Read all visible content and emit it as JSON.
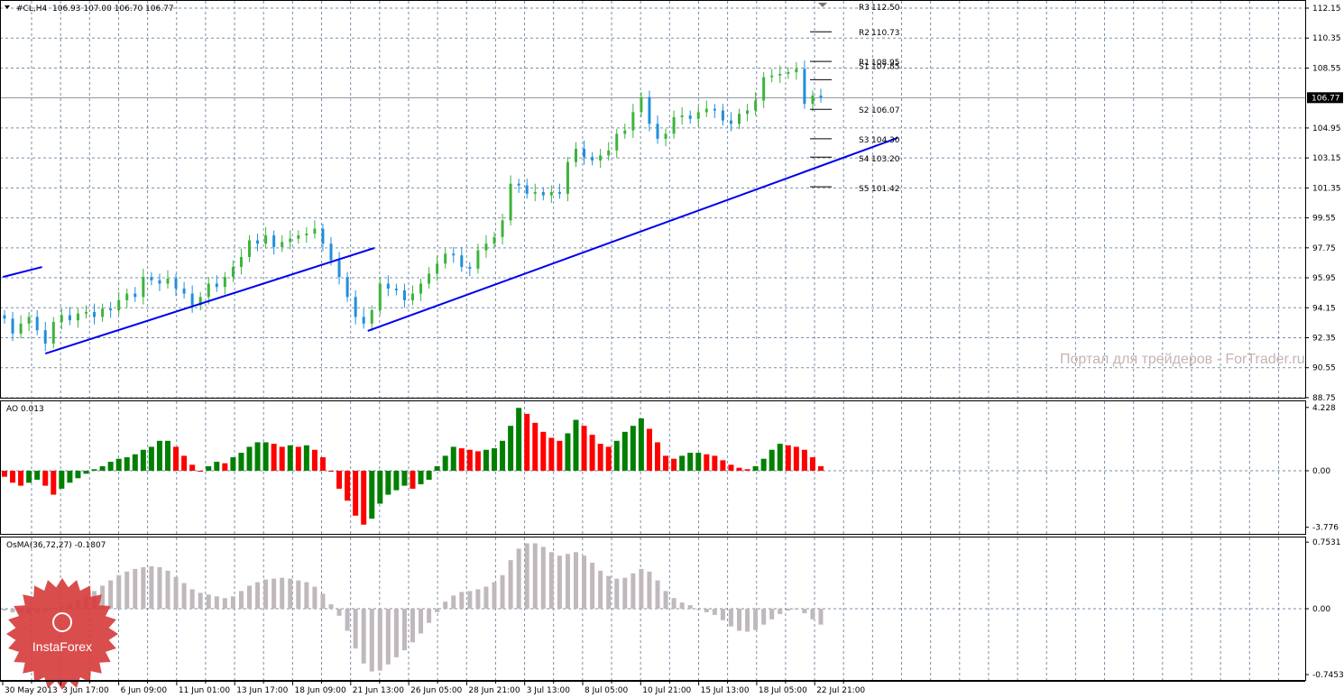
{
  "header": {
    "symbol": "#CL,H4",
    "ohlc": "106.93 107.00 106.70 106.77"
  },
  "watermark": "Портал для трейдеров - ForTrader.ru",
  "logo": {
    "text": "InstaForex",
    "color": "#d63a3a"
  },
  "colors": {
    "bull": "#3cb43c",
    "bear": "#1f8fdc",
    "trendline": "#0000ee",
    "ao_up": "#008000",
    "ao_down": "#ff0000",
    "osma": "#c0b8bc"
  },
  "chart_data": [
    {
      "type": "candlestick",
      "title": "#CL,H4",
      "ylim": [
        88.75,
        112.15
      ],
      "y_ticks": [
        "112.15",
        "110.35",
        "108.55",
        "104.95",
        "103.15",
        "101.35",
        "99.55",
        "97.75",
        "95.95",
        "94.15",
        "92.35",
        "90.55",
        "88.75"
      ],
      "current_price": "106.77",
      "x_tick_labels": [
        "30 May 2013",
        "3 Jun 17:00",
        "6 Jun 09:00",
        "11 Jun 01:00",
        "13 Jun 17:00",
        "18 Jun 09:00",
        "21 Jun 13:00",
        "26 Jun 05:00",
        "28 Jun 21:00",
        "3 Jul 13:00",
        "8 Jul 05:00",
        "10 Jul 21:00",
        "15 Jul 13:00",
        "18 Jul 05:00",
        "22 Jul 21:00"
      ],
      "closes": [
        93.5,
        92.6,
        93.2,
        93.6,
        92.8,
        92.0,
        93.3,
        93.7,
        93.4,
        93.8,
        93.9,
        93.6,
        94.1,
        94.0,
        94.6,
        95.0,
        94.8,
        96.0,
        95.8,
        95.6,
        95.9,
        95.3,
        95.0,
        94.3,
        94.8,
        95.6,
        95.4,
        96.0,
        96.6,
        97.2,
        98.2,
        98.0,
        98.5,
        97.8,
        98.1,
        98.3,
        98.5,
        98.6,
        98.9,
        98.0,
        97.0,
        96.0,
        94.8,
        93.6,
        93.2,
        94.0,
        95.6,
        95.3,
        95.2,
        94.6,
        95.0,
        95.6,
        96.2,
        96.8,
        97.4,
        97.3,
        96.6,
        96.5,
        97.6,
        98.0,
        98.4,
        99.4,
        101.6,
        101.5,
        101.0,
        101.1,
        100.9,
        101.1,
        101.0,
        102.9,
        103.7,
        103.2,
        103.0,
        103.3,
        103.6,
        104.6,
        104.8,
        105.9,
        106.8,
        105.2,
        104.3,
        104.6,
        105.6,
        105.7,
        105.5,
        105.9,
        106.1,
        106.0,
        105.4,
        105.2,
        105.8,
        106.0,
        106.6,
        108.0,
        108.1,
        108.2,
        108.3,
        108.5,
        106.4,
        106.9,
        106.77
      ],
      "pivots": [
        {
          "label": "R3",
          "value": "112.50"
        },
        {
          "label": "R2",
          "value": "110.73"
        },
        {
          "label": "R1",
          "value": "108.95"
        },
        {
          "label": "S1",
          "value": "107.85"
        },
        {
          "label": "S2",
          "value": "106.07"
        },
        {
          "label": "S3",
          "value": "104.30"
        },
        {
          "label": "S4",
          "value": "103.20"
        },
        {
          "label": "S5",
          "value": "101.42"
        }
      ],
      "trendlines": [
        {
          "from": [
            -0.2,
            96.0
          ],
          "to": [
            4.6,
            96.6
          ]
        },
        {
          "from": [
            5.0,
            91.4
          ],
          "to": [
            45.3,
            97.74
          ]
        },
        {
          "from": [
            44.5,
            92.76
          ],
          "to": [
            109.4,
            104.35
          ]
        }
      ]
    },
    {
      "type": "bar",
      "title": "AO 0.013",
      "ylim": [
        -3.776,
        4.228
      ],
      "y_ticks": [
        "4.228",
        "0.00",
        "-3.776"
      ],
      "values": [
        -0.4,
        -0.8,
        -1.0,
        -0.8,
        -0.6,
        -1.0,
        -1.6,
        -1.2,
        -0.8,
        -0.5,
        -0.2,
        0.1,
        0.3,
        0.6,
        0.8,
        0.9,
        1.1,
        1.4,
        1.6,
        2.0,
        2.0,
        1.6,
        1.0,
        0.4,
        0.0,
        0.3,
        0.6,
        0.5,
        0.9,
        1.2,
        1.6,
        1.9,
        1.9,
        1.8,
        1.6,
        1.7,
        1.6,
        1.7,
        1.4,
        0.9,
        0.0,
        -1.2,
        -2.0,
        -3.0,
        -3.6,
        -3.2,
        -2.2,
        -1.6,
        -1.3,
        -1.0,
        -1.2,
        -0.9,
        -0.6,
        0.3,
        1.0,
        1.6,
        1.5,
        1.4,
        1.3,
        1.4,
        1.5,
        2.0,
        3.0,
        4.2,
        3.8,
        3.2,
        2.6,
        2.2,
        2.0,
        2.5,
        3.4,
        3.0,
        2.4,
        1.8,
        1.6,
        2.0,
        2.6,
        3.0,
        3.5,
        2.8,
        1.9,
        1.0,
        0.8,
        1.0,
        1.2,
        1.2,
        1.1,
        1.0,
        0.7,
        0.4,
        0.2,
        0.1,
        0.3,
        0.8,
        1.4,
        1.8,
        1.7,
        1.6,
        1.4,
        0.9,
        0.3
      ]
    },
    {
      "type": "bar",
      "title": "OsMA(36,72,27) -0.1807",
      "ylim": [
        -0.7453,
        0.7531
      ],
      "y_ticks": [
        "0.7531",
        "0.00",
        "-0.7453"
      ],
      "values": [
        -0.02,
        -0.04,
        -0.05,
        -0.06,
        -0.05,
        -0.03,
        0.0,
        0.03,
        0.06,
        0.1,
        0.14,
        0.2,
        0.26,
        0.32,
        0.38,
        0.42,
        0.45,
        0.47,
        0.48,
        0.47,
        0.43,
        0.36,
        0.29,
        0.22,
        0.18,
        0.16,
        0.14,
        0.12,
        0.14,
        0.2,
        0.26,
        0.3,
        0.33,
        0.34,
        0.35,
        0.34,
        0.32,
        0.3,
        0.25,
        0.17,
        0.05,
        -0.08,
        -0.25,
        -0.45,
        -0.62,
        -0.71,
        -0.7,
        -0.63,
        -0.55,
        -0.47,
        -0.38,
        -0.28,
        -0.16,
        -0.04,
        0.08,
        0.15,
        0.19,
        0.2,
        0.22,
        0.25,
        0.3,
        0.38,
        0.55,
        0.68,
        0.74,
        0.74,
        0.7,
        0.64,
        0.6,
        0.62,
        0.64,
        0.6,
        0.52,
        0.43,
        0.37,
        0.34,
        0.35,
        0.4,
        0.45,
        0.42,
        0.32,
        0.2,
        0.12,
        0.07,
        0.04,
        0.0,
        -0.04,
        -0.07,
        -0.13,
        -0.2,
        -0.25,
        -0.26,
        -0.24,
        -0.18,
        -0.12,
        -0.06,
        -0.02,
        0.0,
        -0.05,
        -0.12,
        -0.18
      ]
    }
  ]
}
